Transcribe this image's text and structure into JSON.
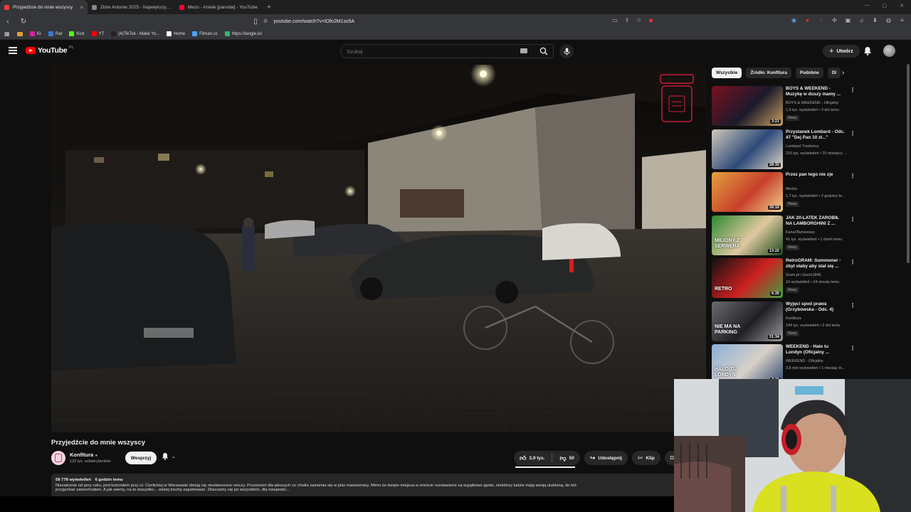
{
  "browser": {
    "tabs": [
      {
        "title": "Przyjedźcie do mnie wszyscy",
        "favicon_color": "#ff3b3b",
        "active": true
      },
      {
        "title": "Złote Antonie 2025 - Największy Plebiscyt",
        "favicon_color": "#888888",
        "active": false
      },
      {
        "title": "Mezo - Aniele [parodia] - YouTube",
        "favicon_color": "#ff0033",
        "active": false
      }
    ],
    "url": "youtube.com/watch?v=lOfo2M1ss5A",
    "bookmarks": [
      {
        "label": "IG",
        "color": "#d6249f"
      },
      {
        "label": "Rat",
        "color": "#3b7bd4"
      },
      {
        "label": "Kick",
        "color": "#53fc18"
      },
      {
        "label": "YT",
        "color": "#ff0000"
      },
      {
        "label": "(4)TikTok - Make Yo...",
        "color": "#222222"
      },
      {
        "label": "Home",
        "color": "#ffffff"
      },
      {
        "label": "Filman.cc",
        "color": "#4aa3ff"
      },
      {
        "label": "https://tangle.io/",
        "color": "#3bb273"
      }
    ]
  },
  "header": {
    "logo_text": "YouTube",
    "country_code": "PL",
    "search_placeholder": "Szukaj",
    "create_label": "Utwórz"
  },
  "video": {
    "title": "Przyjedźcie do mnie wszyscy",
    "channel": "Konfitura",
    "subscribers": "133 tys. subskrybentów",
    "support_label": "Wesprzyj",
    "likes": "3,9 tys.",
    "dislikes": "50",
    "share_label": "Udostępnij",
    "clip_label": "Klip",
    "save_label": "Z",
    "views": "58 778 wyświetleń",
    "published": "6 godzin temu",
    "description": "Niezależnie od pory roku, pod kościołem przy ul. Cierlickiej w Warszawie dzieją się niestworzone rzeczy. Przestrzeń dla pieszych co chwila zamienia się w plac manewrowy. Mimo że święte miejsca w mieście rozstawione są wyjątkowo gęsto, niektórzy ludzie mają swoją ulubioną, do któ",
    "description_line2": "przyjechać samochodem. A jak wiemy, na to wszystko... odziej trochę zaparkować. Zbaczamy się po wszystkich, dla niespodzi..."
  },
  "sidebar": {
    "chips": [
      "Wszystkie",
      "Źródło: Konfitura",
      "Podobne",
      "Dl"
    ],
    "recommendations": [
      {
        "title": "BOYS & WEEKEND - Muzykę w duszy mamy ...",
        "channel": "BOYS & WEEKEND - Oficjalny",
        "stats": "1,9 tys. wyświetleń • 3 dni temu",
        "badge": "Nowy",
        "duration": "3:21",
        "colors": [
          "#7a1020",
          "#1a1a2a",
          "#c9a060"
        ]
      },
      {
        "title": "Przystanek Lombard - Odc. 47 \"Dej Pan 10 zł...\"",
        "channel": "Lombard Trzebnica",
        "stats": "216 tys. wyświetleń • 10 miesięcy ...",
        "badge": "",
        "duration": "28:32",
        "colors": [
          "#d0c8b8",
          "#2c4a7a",
          "#e0d8c8"
        ]
      },
      {
        "title": "Przez pan tego nie zje",
        "channel": "Mechu",
        "stats": "1,7 tys. wyświetleń • 2 godziny te...",
        "badge": "Nowy",
        "duration": "26:16",
        "colors": [
          "#e3a040",
          "#c8402a",
          "#f0d090"
        ]
      },
      {
        "title": "JAK 20-LATEK ZAROBIŁ NA LAMBORGHINI Z ...",
        "channel": "Kanał Biznesowy",
        "stats": "41 tys. wyświetleń • 1 dzień temu",
        "badge": "Nowy",
        "duration": "13:22",
        "colors": [
          "#2a8a30",
          "#e0c8a0",
          "#1a4a1a"
        ],
        "thumb_text": "MILIONY Z SERWERA"
      },
      {
        "title": "RetroGRAM: Summoner - zbyt słaby aby stał się ...",
        "channel": "Gram.pl i Gucio1846",
        "stats": "16 wyświetleń • 24 minuty temu",
        "badge": "Nowy",
        "duration": "6:35",
        "colors": [
          "#111111",
          "#cc2020",
          "#40a040"
        ],
        "thumb_text": "RETRO"
      },
      {
        "title": "Wyjęci spod prawa (Grzybowska - Odc. 4)",
        "channel": "Konfitura",
        "stats": "144 tys. wyświetleń • 2 dni temu",
        "badge": "Nowy",
        "duration": "31:34",
        "colors": [
          "#6a6a70",
          "#202024",
          "#9a9aa0"
        ],
        "thumb_text": "NIE MA NA PARKING"
      },
      {
        "title": "WEEKEND - Halo tu Londyn (Oficjalny ...",
        "channel": "WEEKEND - Oficjalny",
        "stats": "3,8 mln wyświetleń • 1 miesiąc te...",
        "badge": "",
        "duration": "3:21",
        "colors": [
          "#8ab0d8",
          "#d8d0c8",
          "#304a70"
        ],
        "thumb_text": "HALO TU LONDYN"
      }
    ]
  },
  "icons": {
    "hamburger": "menu-icon",
    "search": "search-icon",
    "mic": "mic-icon",
    "bell": "bell-icon",
    "like": "thumbs-up-icon",
    "dislike": "thumbs-down-icon",
    "share": "share-icon",
    "clip": "scissors-icon",
    "save": "save-icon",
    "overlay_logo": "konfitura-jar-icon"
  },
  "colors": {
    "background": "#0f0f0f",
    "accent": "#ff0000",
    "chip_bg": "#272727",
    "text": "#f1f1f1"
  }
}
